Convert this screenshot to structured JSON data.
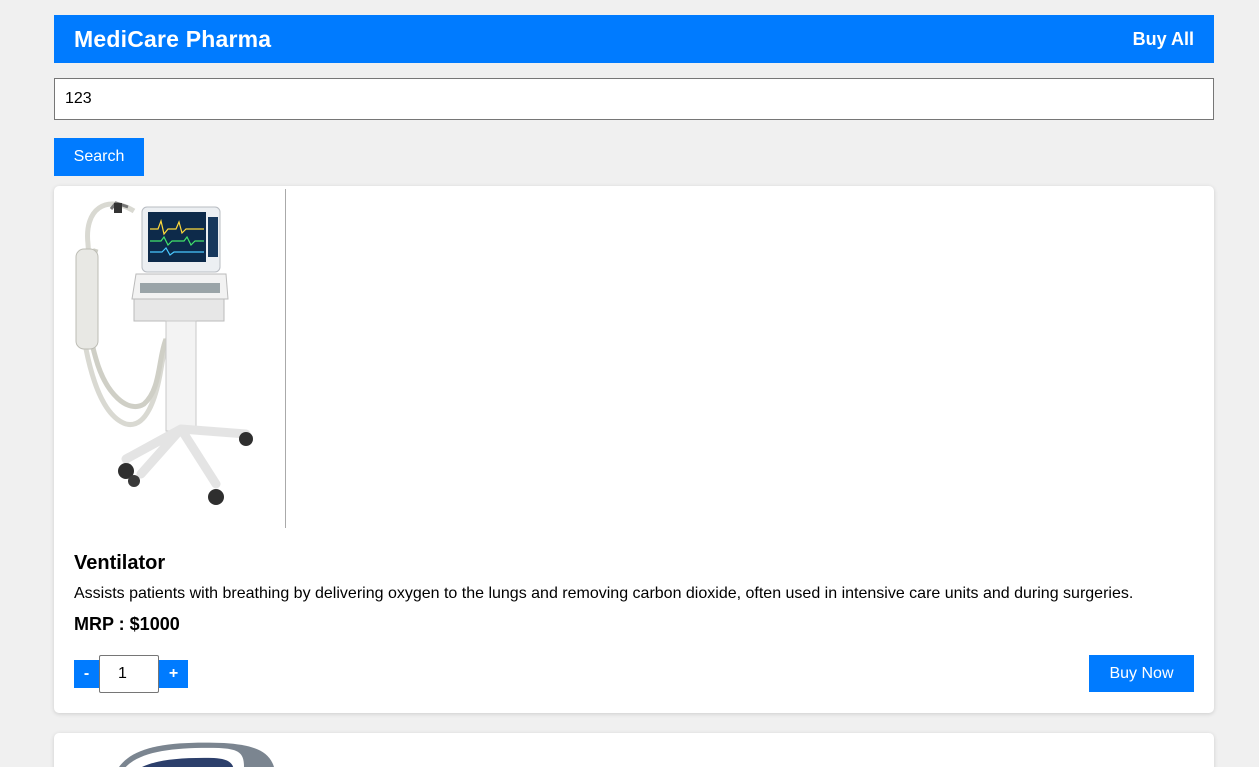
{
  "header": {
    "brand": "MediCare Pharma",
    "buy_all_label": "Buy All"
  },
  "search": {
    "value": "123",
    "button_label": "Search"
  },
  "products": [
    {
      "image_icon": "ventilator-image",
      "name": "Ventilator",
      "description": "Assists patients with breathing by delivering oxygen to the lungs and removing carbon dioxide, often used in intensive care units and during surgeries.",
      "price": "MRP : $1000",
      "quantity": "1",
      "minus_label": "-",
      "plus_label": "+",
      "buy_label": "Buy Now"
    },
    {
      "image_icon": "blood-pressure-monitor-image"
    }
  ],
  "colors": {
    "accent": "#007bff",
    "background": "#f0f0f0"
  }
}
